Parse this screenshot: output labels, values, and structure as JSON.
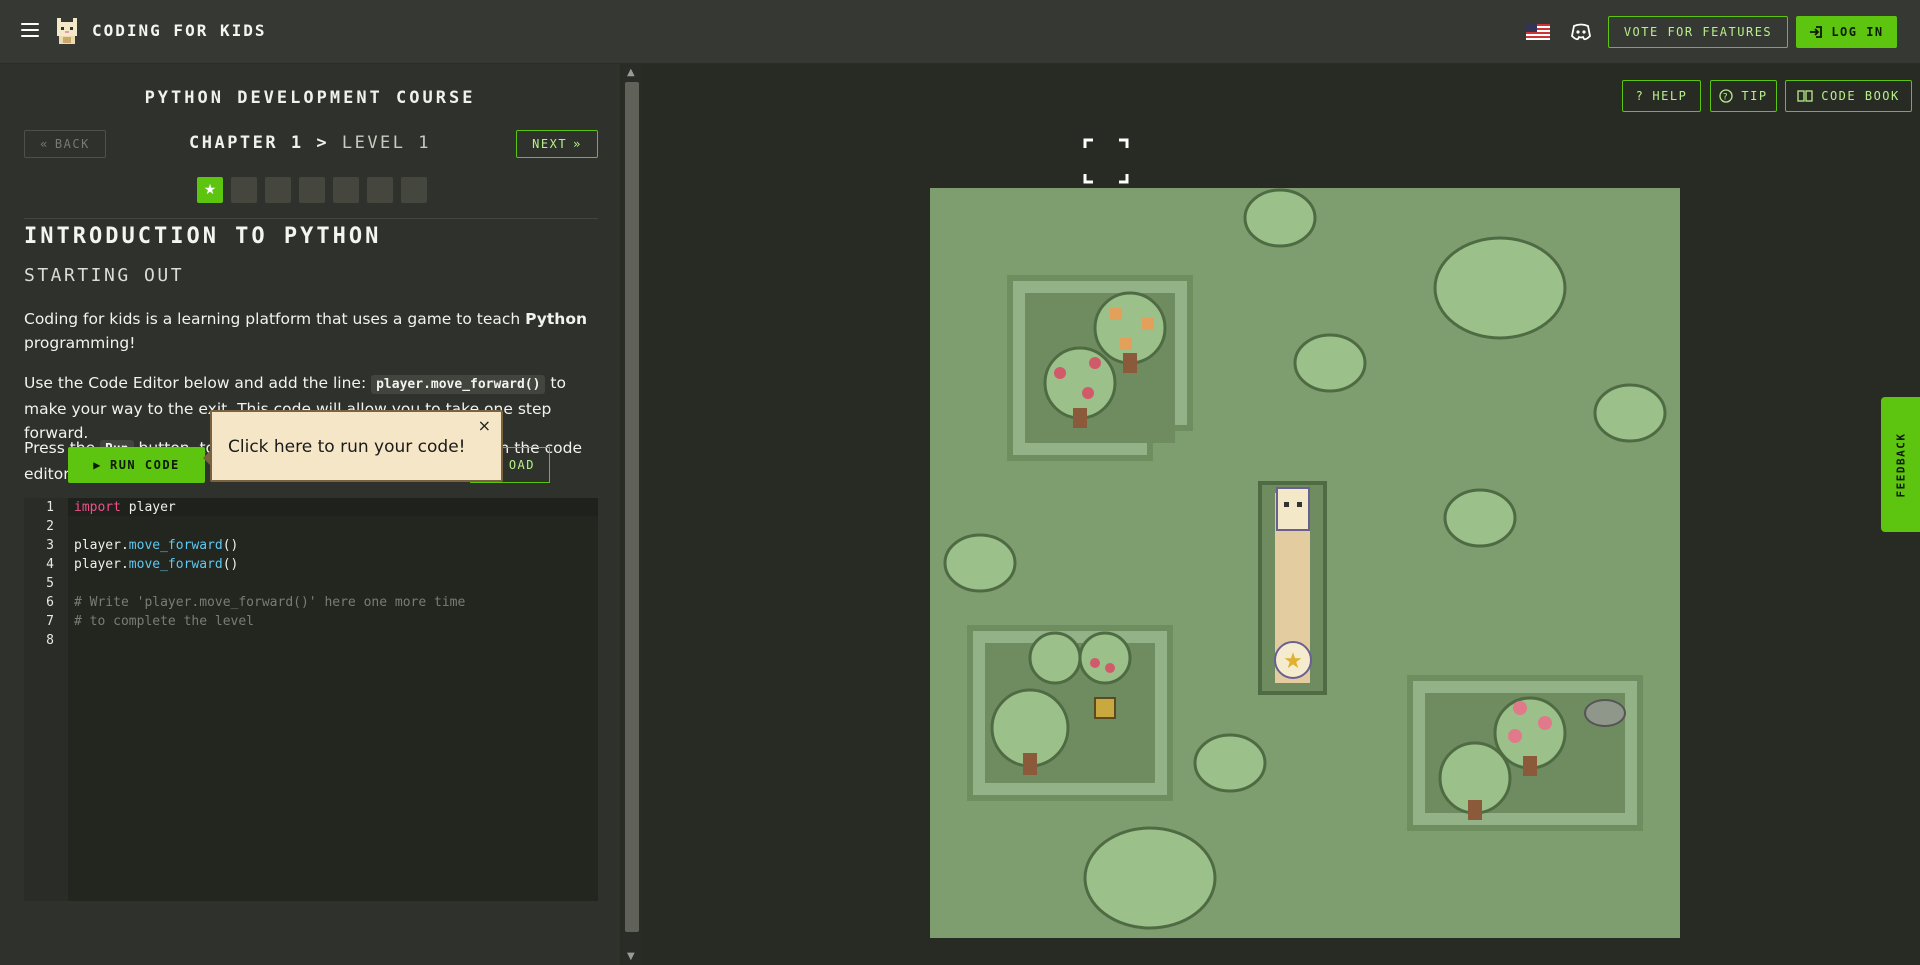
{
  "header": {
    "brand": "CODING FOR KIDS",
    "vote_label": "VOTE FOR FEATURES",
    "login_label": "LOG IN"
  },
  "course": {
    "title": "PYTHON DEVELOPMENT COURSE",
    "back_label": "BACK",
    "chapter": "CHAPTER 1",
    "level": "LEVEL 1",
    "next_label": "NEXT",
    "levels_total": 7,
    "current_level": 1
  },
  "lesson": {
    "heading": "INTRODUCTION TO PYTHON",
    "subheading": "STARTING OUT",
    "p1_before": "Coding for kids is a learning platform that uses a game to teach ",
    "p1_bold": "Python",
    "p1_after": " programming!",
    "p2_before": "Use the Code Editor below and add the line: ",
    "p2_code": "player.move_forward()",
    "p2_after": " to make your way to the exit. This code will allow you to take one step forward.",
    "p3_before": "Press the ",
    "p3_code": "Run",
    "p3_after": " button, to execute the code you have written in the code editor."
  },
  "actions": {
    "run_label": "RUN CODE",
    "upload_fragment": "OAD"
  },
  "tooltip": {
    "text": "Click here to run your code!",
    "close": "×"
  },
  "editor": {
    "line_numbers": [
      "1",
      "2",
      "3",
      "4",
      "5",
      "6",
      "7",
      "8"
    ],
    "lines": {
      "l1_kw": "import",
      "l1_rest": " player",
      "l3_obj": "player.",
      "l3_fn": "move_forward",
      "l3_paren": "()",
      "l4_obj": "player.",
      "l4_fn": "move_forward",
      "l4_paren": "()",
      "l6": "# Write 'player.move_forward()' here one more time",
      "l7": "# to complete the level"
    }
  },
  "toolbar": {
    "help_label": "HELP",
    "tip_label": "TIP",
    "codebook_label": "CODE BOOK"
  },
  "feedback_label": "FEEDBACK",
  "colors": {
    "accent": "#5dc410",
    "panel": "#2f312c",
    "game_ground": "#7f9e6f",
    "tooltip_bg": "#f5e6c8"
  }
}
